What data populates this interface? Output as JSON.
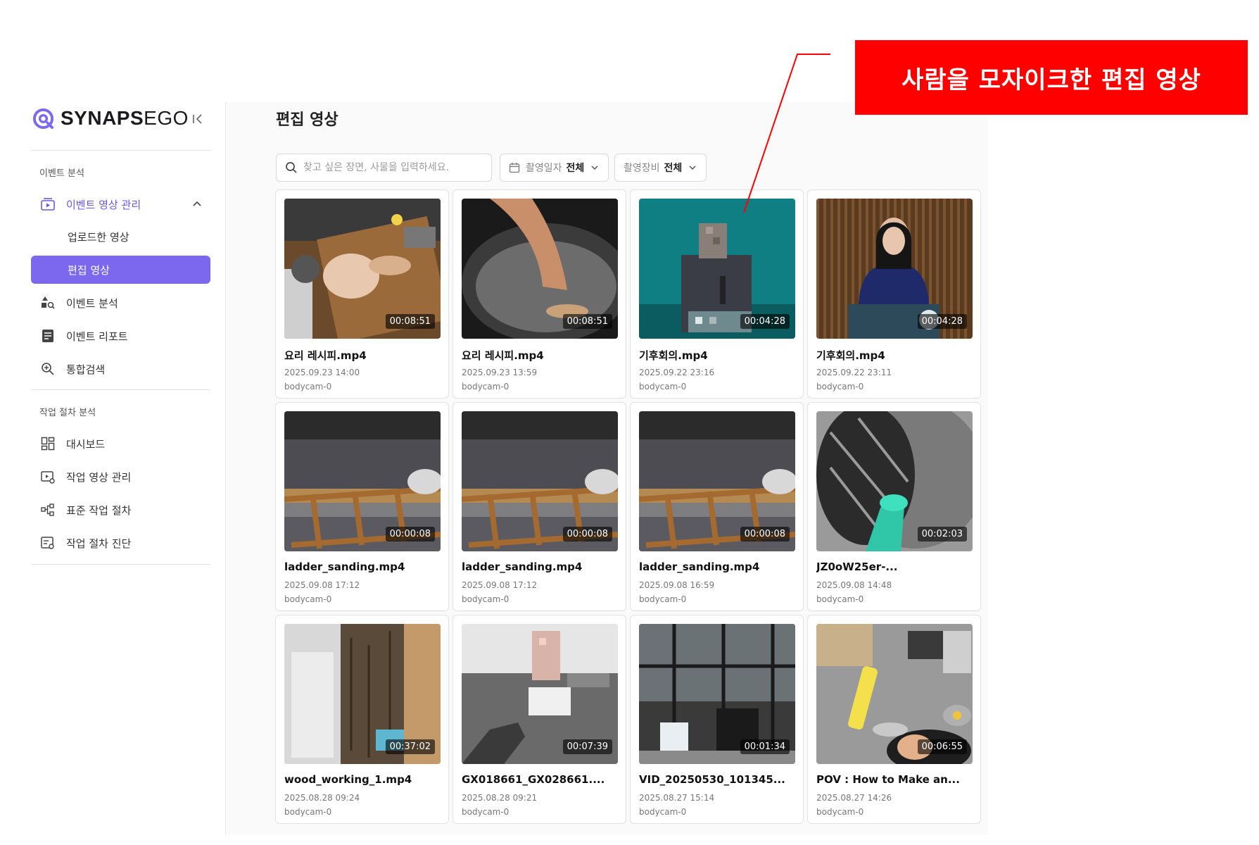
{
  "brand": {
    "name_bold": "SYNAPS",
    "name_light": "EGO"
  },
  "sidebar": {
    "section1_label": "이벤트 분석",
    "section2_label": "작업 절차 분석",
    "event_video_mgmt": "이벤트 영상 관리",
    "uploaded_videos": "업로드한 영상",
    "edited_videos": "편집 영상",
    "event_analysis": "이벤트 분석",
    "event_report": "이벤트 리포트",
    "integrated_search": "통합검색",
    "dashboard": "대시보드",
    "task_video_mgmt": "작업 영상 관리",
    "standard_procedure": "표준 작업 절차",
    "procedure_diagnosis": "작업 절차 진단"
  },
  "main": {
    "title": "편집 영상",
    "search_placeholder": "찾고 싶은 장면, 사물을 입력하세요.",
    "filter_date_label": "촬영일자",
    "filter_date_value": "전체",
    "filter_device_label": "촬영장비",
    "filter_device_value": "전체"
  },
  "videos": [
    {
      "title": "요리 레시피.mp4",
      "duration": "00:08:51",
      "date": "2025.09.23 14:00",
      "device": "bodycam-0",
      "thumb": "cooking-chicken"
    },
    {
      "title": "요리 레시피.mp4",
      "duration": "00:08:51",
      "date": "2025.09.23 13:59",
      "device": "bodycam-0",
      "thumb": "cooking-pan"
    },
    {
      "title": "기후회의.mp4",
      "duration": "00:04:28",
      "date": "2025.09.22 23:16",
      "device": "bodycam-0",
      "thumb": "speaker-mosaic"
    },
    {
      "title": "기후회의.mp4",
      "duration": "00:04:28",
      "date": "2025.09.22 23:11",
      "device": "bodycam-0",
      "thumb": "speaker-woman"
    },
    {
      "title": "ladder_sanding.mp4",
      "duration": "00:00:08",
      "date": "2025.09.08 17:12",
      "device": "bodycam-0",
      "thumb": "ladder"
    },
    {
      "title": "ladder_sanding.mp4",
      "duration": "00:00:08",
      "date": "2025.09.08 17:12",
      "device": "bodycam-0",
      "thumb": "ladder"
    },
    {
      "title": "ladder_sanding.mp4",
      "duration": "00:00:08",
      "date": "2025.09.08 16:59",
      "device": "bodycam-0",
      "thumb": "ladder"
    },
    {
      "title": "JZ0oW25er-...",
      "duration": "00:02:03",
      "date": "2025.09.08 14:48",
      "device": "bodycam-0",
      "thumb": "duct"
    },
    {
      "title": "wood_working_1.mp4",
      "duration": "00:37:02",
      "date": "2025.08.28 09:24",
      "device": "bodycam-0",
      "thumb": "workshop"
    },
    {
      "title": "GX018661_GX028661....",
      "duration": "00:07:39",
      "date": "2025.08.28 09:21",
      "device": "bodycam-0",
      "thumb": "office-mosaic"
    },
    {
      "title": "VID_20250530_101345...",
      "duration": "00:01:34",
      "date": "2025.08.27 15:14",
      "device": "bodycam-0",
      "thumb": "office-glass"
    },
    {
      "title": "POV : How to Make an...",
      "duration": "00:06:55",
      "date": "2025.08.27 14:26",
      "device": "bodycam-0",
      "thumb": "kitchen"
    }
  ],
  "annotation": {
    "text": "사람을 모자이크한 편집 영상"
  },
  "colors": {
    "accent": "#7b68ee",
    "callout": "#ff0000"
  }
}
